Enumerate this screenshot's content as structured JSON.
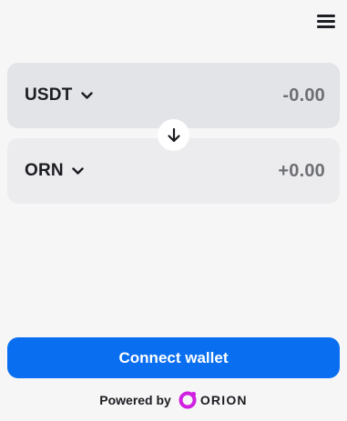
{
  "header": {
    "menu_icon": "hamburger-menu-icon"
  },
  "swap": {
    "from": {
      "token": "USDT",
      "amount": "-0.00"
    },
    "to": {
      "token": "ORN",
      "amount": "+0.00"
    },
    "toggle_icon": "arrow-down-icon"
  },
  "connect_button": {
    "label": "Connect wallet"
  },
  "footer": {
    "powered_by": "Powered by",
    "brand": "ORION"
  },
  "colors": {
    "accent": "#0a6ef0",
    "brand_logo": "#d020e0",
    "from_box": "#e2e4e7",
    "to_box": "#ececef"
  }
}
